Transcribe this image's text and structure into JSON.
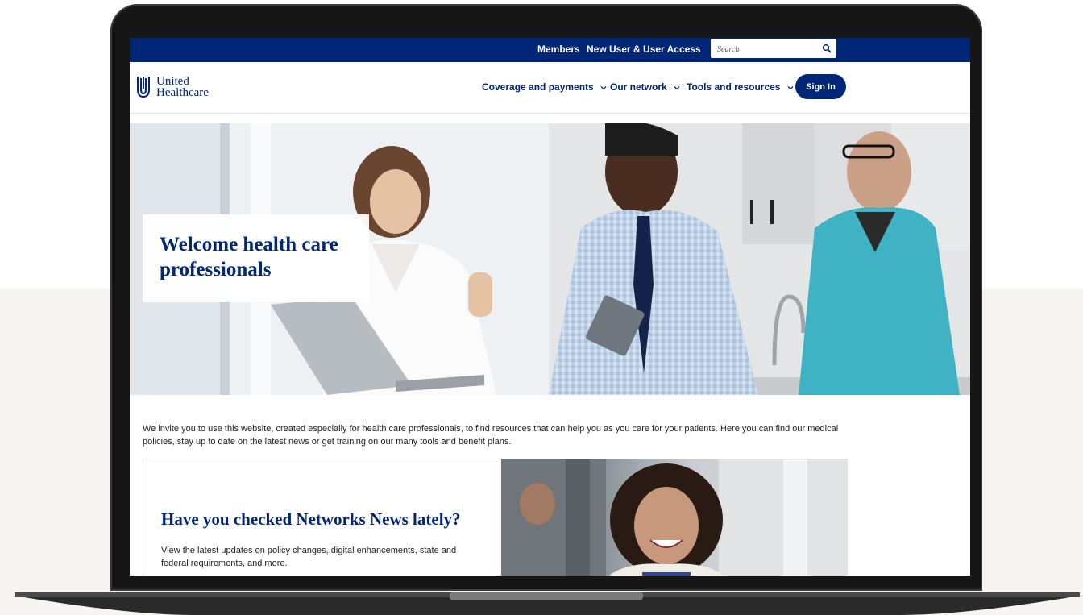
{
  "utility_nav": {
    "members": "Members",
    "new_user": "New User & User Access",
    "search_placeholder": "Search"
  },
  "brand": {
    "line1": "United",
    "line2": "Healthcare"
  },
  "main_nav": {
    "items": [
      {
        "label": "Coverage and payments"
      },
      {
        "label": "Our network"
      },
      {
        "label": "Tools and resources"
      }
    ],
    "signin": "Sign In"
  },
  "hero": {
    "title": "Welcome health care professionals"
  },
  "intro": "We invite you to use this website, created especially for health care professionals, to find resources that can help you as you care for your patients. Here you can find our medical policies, stay up to date on the latest news or get training on our many tools and benefit plans.",
  "news": {
    "title": "Have you checked Networks News lately?",
    "text": "View the latest updates on policy changes, digital enhancements, state and federal requirements, and more."
  },
  "colors": {
    "brand_navy": "#002677",
    "frame": "#161616",
    "page_bg": "#f6f5f1"
  }
}
